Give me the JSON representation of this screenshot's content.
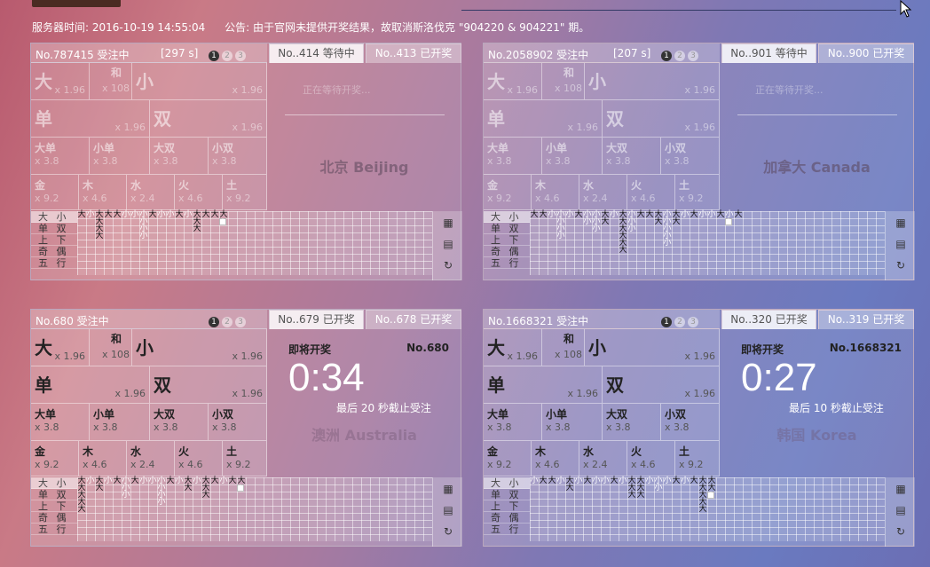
{
  "server_time": "服务器时间: 2016-10-19 14:55:04",
  "announcement": "公告: 由于官网未提供开奖结果，故取消斯洛伐克 \"904220 & 904221\" 期。",
  "icons": [
    "pagination-dot",
    "grid-icon",
    "list-icon",
    "refresh-icon",
    "cursor-icon"
  ],
  "panels": [
    {
      "id": "p1",
      "number": "No.787415 受注中",
      "seconds": "[297 s]",
      "dots": [
        "1",
        "2",
        "3"
      ],
      "tab1": "No..414 等待中",
      "tab2": "No..413 已开奖",
      "state": "waiting",
      "wait_text": "正在等待开奖...",
      "city": "北京 Beijing",
      "options": {
        "da": "大",
        "da_odds": "x 1.96",
        "he": "和",
        "he_odds": "x 108",
        "xiao": "小",
        "xiao_odds": "x 1.96",
        "dan": "单",
        "dan_odds": "x 1.96",
        "shuang": "双",
        "shuang_odds": "x 1.96",
        "dadan": "大单",
        "dadan_odds": "x 3.8",
        "xiaodan": "小单",
        "xiaodan_odds": "x 3.8",
        "dashuang": "大双",
        "dashuang_odds": "x 3.8",
        "xiaoshuang": "小双",
        "xiaoshuang_odds": "x 3.8",
        "jin": "金",
        "jin_odds": "x 9.2",
        "mu": "木",
        "mu_odds": "x 4.6",
        "shui": "水",
        "shui_odds": "x 2.4",
        "huo": "火",
        "huo_odds": "x 4.6",
        "tu": "土",
        "tu_odds": "x 9.2"
      },
      "trend_cols": [
        [
          "大"
        ],
        [
          "小"
        ],
        [
          "大",
          "大",
          "大",
          "大"
        ],
        [
          "大"
        ],
        [
          "大"
        ],
        [
          "小"
        ],
        [
          "小"
        ],
        [
          "小",
          "小",
          "小",
          "小"
        ],
        [
          "大"
        ],
        [
          "小"
        ],
        [
          "小"
        ],
        [
          "大"
        ],
        [
          "小"
        ],
        [
          "大",
          "大",
          "大"
        ],
        [
          "大"
        ],
        [
          "大"
        ],
        [
          "大",
          "?"
        ]
      ]
    },
    {
      "id": "p2",
      "number": "No.2058902 受注中",
      "seconds": "[207 s]",
      "dots": [
        "1",
        "2",
        "3"
      ],
      "tab1": "No..901 等待中",
      "tab2": "No..900 已开奖",
      "state": "waiting",
      "wait_text": "正在等待开奖...",
      "city": "加拿大 Canada",
      "options": {
        "da": "大",
        "da_odds": "x 1.96",
        "he": "和",
        "he_odds": "x 108",
        "xiao": "小",
        "xiao_odds": "x 1.96",
        "dan": "单",
        "dan_odds": "x 1.96",
        "shuang": "双",
        "shuang_odds": "x 1.96",
        "dadan": "大单",
        "dadan_odds": "x 3.8",
        "xiaodan": "小单",
        "xiaodan_odds": "x 3.8",
        "dashuang": "大双",
        "dashuang_odds": "x 3.8",
        "xiaoshuang": "小双",
        "xiaoshuang_odds": "x 3.8",
        "jin": "金",
        "jin_odds": "x 9.2",
        "mu": "木",
        "mu_odds": "x 4.6",
        "shui": "水",
        "shui_odds": "x 2.4",
        "huo": "火",
        "huo_odds": "x 4.6",
        "tu": "土",
        "tu_odds": "x 9.2"
      },
      "trend_cols": [
        [
          "大"
        ],
        [
          "大"
        ],
        [
          "小"
        ],
        [
          "小",
          "小",
          "小",
          "小"
        ],
        [
          "小"
        ],
        [
          "大"
        ],
        [
          "小",
          "小"
        ],
        [
          "小",
          "小",
          "小"
        ],
        [
          "大",
          "大"
        ],
        [
          "小"
        ],
        [
          "大",
          "大",
          "大",
          "大",
          "大",
          "大"
        ],
        [
          "小",
          "小",
          "小"
        ],
        [
          "大"
        ],
        [
          "大"
        ],
        [
          "大",
          "大"
        ],
        [
          "小",
          "小",
          "小",
          "小",
          "小"
        ],
        [
          "大",
          "大"
        ],
        [
          "小"
        ],
        [
          "大"
        ],
        [
          "小"
        ],
        [
          "小"
        ],
        [
          "大"
        ],
        [
          "小",
          "?"
        ],
        [
          "大"
        ]
      ]
    },
    {
      "id": "p3",
      "number": "No.680 受注中",
      "seconds": "",
      "dots": [
        "1",
        "2",
        "3"
      ],
      "tab1": "No..679 已开奖",
      "tab2": "No..678 已开奖",
      "state": "countdown",
      "draw_label": "即将开奖",
      "draw_no": "No.680",
      "countdown": "0:34",
      "cutoff": "最后 20 秒截止受注",
      "city": "澳洲 Australia",
      "options": {
        "da": "大",
        "da_odds": "x 1.96",
        "he": "和",
        "he_odds": "x 108",
        "xiao": "小",
        "xiao_odds": "x 1.96",
        "dan": "单",
        "dan_odds": "x 1.96",
        "shuang": "双",
        "shuang_odds": "x 1.96",
        "dadan": "大单",
        "dadan_odds": "x 3.8",
        "xiaodan": "小单",
        "xiaodan_odds": "x 3.8",
        "dashuang": "大双",
        "dashuang_odds": "x 3.8",
        "xiaoshuang": "小双",
        "xiaoshuang_odds": "x 3.8",
        "jin": "金",
        "jin_odds": "x 9.2",
        "mu": "木",
        "mu_odds": "x 4.6",
        "shui": "水",
        "shui_odds": "x 2.4",
        "huo": "火",
        "huo_odds": "x 4.6",
        "tu": "土",
        "tu_odds": "x 9.2"
      },
      "trend_cols": [
        [
          "大",
          "大",
          "大",
          "大",
          "大"
        ],
        [
          "小"
        ],
        [
          "大",
          "大"
        ],
        [
          "小"
        ],
        [
          "大"
        ],
        [
          "小",
          "小",
          "小"
        ],
        [
          "大"
        ],
        [
          "小"
        ],
        [
          "小"
        ],
        [
          "小",
          "小",
          "小",
          "小"
        ],
        [
          "大"
        ],
        [
          "小"
        ],
        [
          "大",
          "大"
        ],
        [
          "小"
        ],
        [
          "大",
          "大",
          "大"
        ],
        [
          "大"
        ],
        [
          "小"
        ],
        [
          "大"
        ],
        [
          "大",
          "?"
        ]
      ]
    },
    {
      "id": "p4",
      "number": "No.1668321 受注中",
      "seconds": "",
      "dots": [
        "1",
        "2",
        "3"
      ],
      "tab1": "No..320 已开奖",
      "tab2": "No..319 已开奖",
      "state": "countdown",
      "draw_label": "即将开奖",
      "draw_no": "No.1668321",
      "countdown": "0:27",
      "cutoff": "最后 10 秒截止受注",
      "city": "韩国 Korea",
      "options": {
        "da": "大",
        "da_odds": "x 1.96",
        "he": "和",
        "he_odds": "x 108",
        "xiao": "小",
        "xiao_odds": "x 1.96",
        "dan": "单",
        "dan_odds": "x 1.96",
        "shuang": "双",
        "shuang_odds": "x 1.96",
        "dadan": "大单",
        "dadan_odds": "x 3.8",
        "xiaodan": "小单",
        "xiaodan_odds": "x 3.8",
        "dashuang": "大双",
        "dashuang_odds": "x 3.8",
        "xiaoshuang": "小双",
        "xiaoshuang_odds": "x 3.8",
        "jin": "金",
        "jin_odds": "x 9.2",
        "mu": "木",
        "mu_odds": "x 4.6",
        "shui": "水",
        "shui_odds": "x 2.4",
        "huo": "火",
        "huo_odds": "x 4.6",
        "tu": "土",
        "tu_odds": "x 9.2"
      },
      "trend_cols": [
        [
          "小"
        ],
        [
          "大"
        ],
        [
          "大"
        ],
        [
          "小"
        ],
        [
          "大",
          "大"
        ],
        [
          "小"
        ],
        [
          "大"
        ],
        [
          "小"
        ],
        [
          "小"
        ],
        [
          "大"
        ],
        [
          "小"
        ],
        [
          "大",
          "大",
          "大"
        ],
        [
          "大",
          "大",
          "大"
        ],
        [
          "小"
        ],
        [
          "小",
          "小"
        ],
        [
          "小"
        ],
        [
          "大"
        ],
        [
          "小"
        ],
        [
          "大"
        ],
        [
          "大",
          "大",
          "大",
          "大",
          "大"
        ],
        [
          "大",
          "大",
          "?"
        ]
      ]
    }
  ],
  "legend": [
    "大 小",
    "单 双",
    "上 下",
    "奇 偶",
    "五 行"
  ]
}
